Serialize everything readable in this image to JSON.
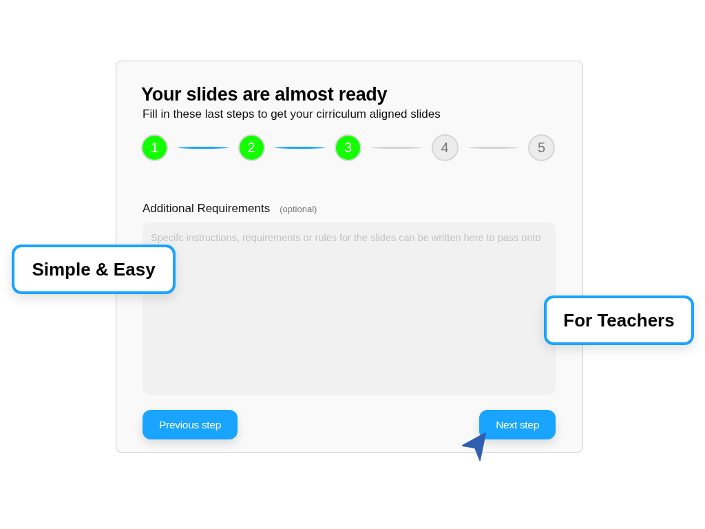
{
  "title": "Your slides are almost ready",
  "subtitle": "Fill in these last steps to get your cirriculum aligned slides",
  "steps": [
    {
      "label": "1",
      "completed": true
    },
    {
      "label": "2",
      "completed": true
    },
    {
      "label": "3",
      "completed": true
    },
    {
      "label": "4",
      "completed": false
    },
    {
      "label": "5",
      "completed": false
    }
  ],
  "field": {
    "label": "Additional Requirements",
    "hint": "(optional)",
    "placeholder": "Specifc instructions, requirements or rules for the slides can be written here to pass onto"
  },
  "buttons": [
    {
      "label": "Previous step"
    },
    {
      "label": "Next step"
    }
  ],
  "callouts": [
    {
      "label": "Simple & Easy"
    },
    {
      "label": "For Teachers"
    }
  ]
}
